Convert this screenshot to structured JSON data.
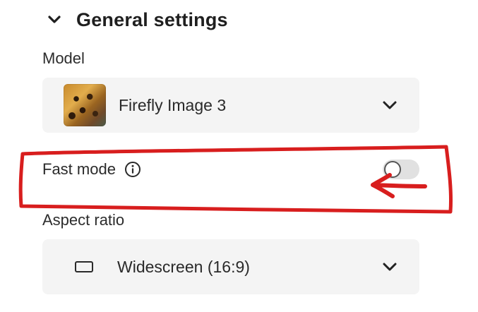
{
  "general_settings": {
    "title": "General settings",
    "expanded": true,
    "chevron_icon": "chevron-down-icon"
  },
  "model": {
    "label": "Model",
    "selected": "Firefly Image 3",
    "thumbnail": "leopard-thumbnail",
    "chevron_icon": "chevron-down-icon"
  },
  "fast_mode": {
    "label": "Fast mode",
    "info_icon": "info-icon",
    "enabled": false
  },
  "aspect_ratio": {
    "label": "Aspect ratio",
    "selected": "Widescreen (16:9)",
    "icon": "widescreen-icon",
    "chevron_icon": "chevron-down-icon"
  },
  "annotation": {
    "highlight_color": "#d81e1e",
    "shapes": [
      "rectangle-outline",
      "left-arrow"
    ]
  },
  "colors": {
    "dropdown_bg": "#f4f4f4",
    "toggle_off_bg": "#e1e1e1",
    "text": "#2a2a2a"
  }
}
